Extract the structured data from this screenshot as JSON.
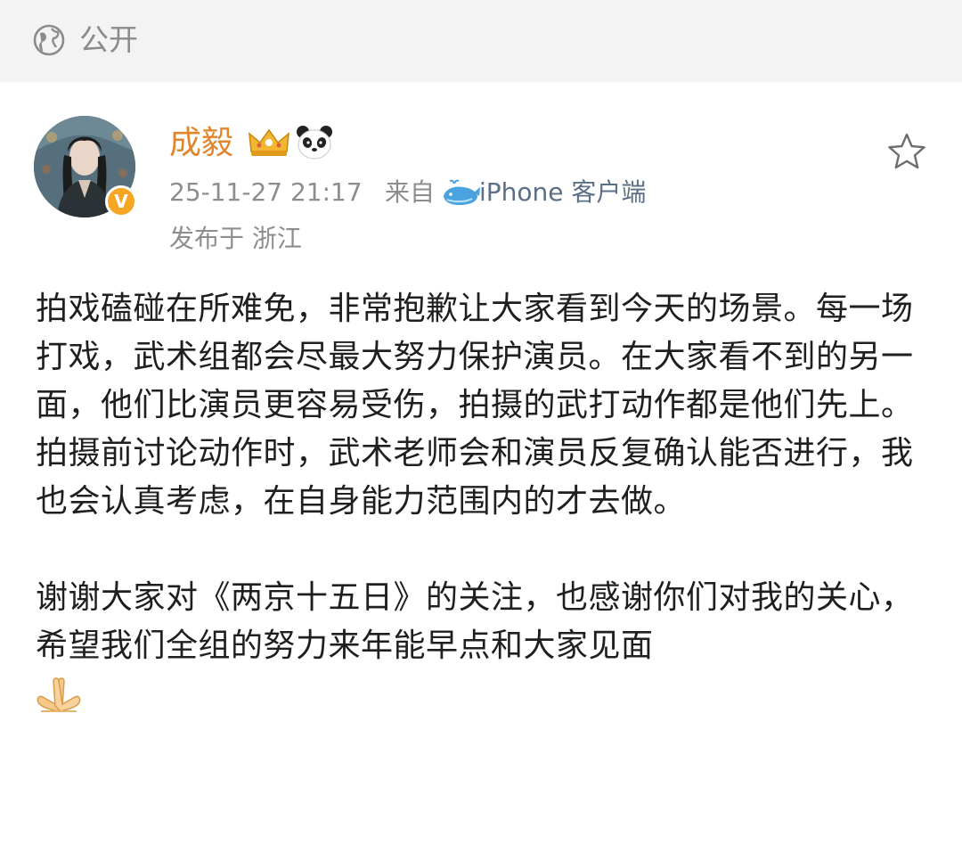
{
  "header": {
    "visibility_icon": "globe-icon",
    "visibility_label": "公开"
  },
  "post": {
    "author": {
      "name": "成毅",
      "avatar": "avatar",
      "verified_badge": "V",
      "badges": [
        "crown-icon",
        "panda-icon"
      ]
    },
    "timestamp": "25-11-27 21:17",
    "source_prefix": "来自",
    "source_icon": "whale-icon",
    "source_app": "iPhone 客户端",
    "location": "发布于 浙江",
    "favorite_icon": "star-icon",
    "paragraphs": [
      "拍戏磕碰在所难免，非常抱歉让大家看到今天的场景。每一场打戏，武术组都会尽最大努力保护演员。在大家看不到的另一面，他们比演员更容易受伤，拍摄的武打动作都是他们先上。拍摄前讨论动作时，武术老师会和演员反复确认能否进行，我也会认真考虑，在自身能力范围内的才去做。",
      "谢谢大家对《两京十五日》的关注，也感谢你们对我的关心，希望我们全组的努力来年能早点和大家见面"
    ],
    "closing_emoji": "praying-hands-icon"
  },
  "colors": {
    "header_bg": "#f3f3f3",
    "author_name": "#e2842c",
    "meta_text": "#8d8d8d",
    "source_link": "#5b6f86",
    "verified_badge": "#f5a623",
    "body_text": "#1f1f1f"
  }
}
